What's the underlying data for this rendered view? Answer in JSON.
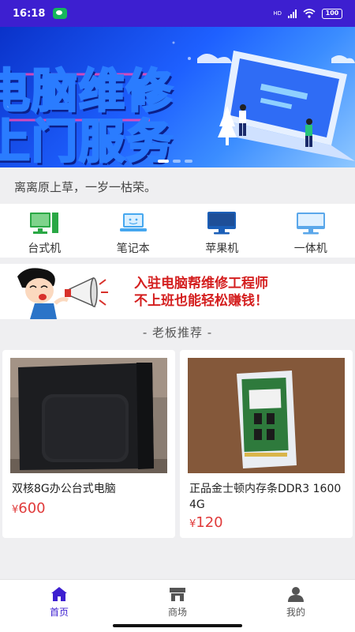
{
  "status_bar": {
    "time": "16:18",
    "network": "HD",
    "battery": "100"
  },
  "banner": {
    "line1": "电脑维修",
    "line2": "上门服务"
  },
  "slogan": "离离原上草，一岁一枯荣。",
  "categories": [
    {
      "label": "台式机",
      "icon": "desktop-icon"
    },
    {
      "label": "笔记本",
      "icon": "laptop-icon"
    },
    {
      "label": "苹果机",
      "icon": "imac-icon"
    },
    {
      "label": "一体机",
      "icon": "all-in-one-icon"
    }
  ],
  "ad": {
    "line1": "入驻电脑帮维修工程师",
    "line2": "不上班也能轻松赚钱！"
  },
  "recommend_title": "- 老板推荐 -",
  "products": [
    {
      "name": "双核8G办公台式电脑",
      "currency": "¥",
      "price": "600"
    },
    {
      "name": "正品金士顿内存条DDR3 1600 4G",
      "currency": "¥",
      "price": "120"
    }
  ],
  "tabbar": [
    {
      "label": "首页",
      "active": true
    },
    {
      "label": "商场",
      "active": false
    },
    {
      "label": "我的",
      "active": false
    }
  ],
  "colors": {
    "accent": "#3d1fd0",
    "price": "#e03a3a"
  }
}
